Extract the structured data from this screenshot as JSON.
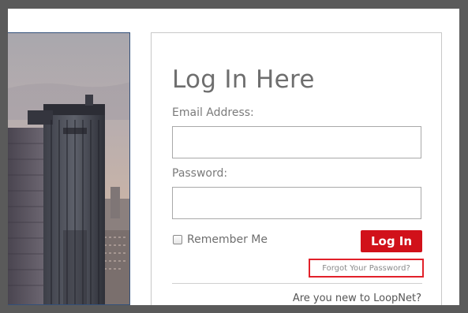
{
  "login": {
    "title": "Log In Here",
    "email_label": "Email Address:",
    "email_value": "",
    "password_label": "Password:",
    "password_value": "",
    "remember_label": "Remember Me",
    "remember_checked": false,
    "login_button": "Log In",
    "forgot_link": "Forgot Your Password?",
    "new_user_text": "Are you new to LoopNet?"
  },
  "colors": {
    "button_red": "#d1111a",
    "highlight_red": "#e2212a",
    "text_gray": "#6e6e6e"
  }
}
